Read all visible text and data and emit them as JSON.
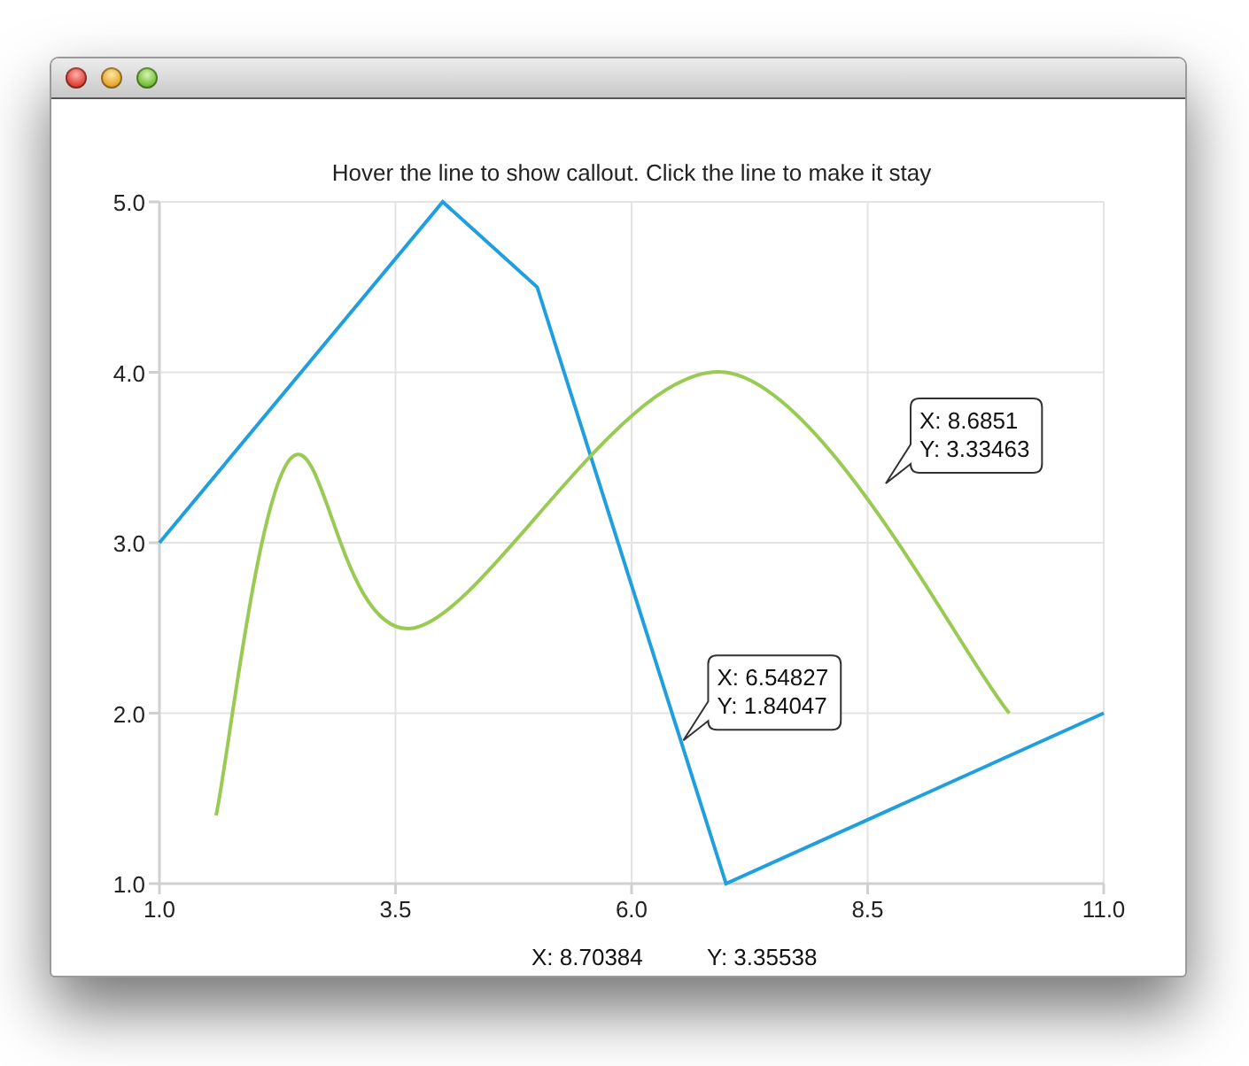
{
  "window": {
    "buttons": [
      {
        "kind": "close"
      },
      {
        "kind": "minimize"
      },
      {
        "kind": "zoom"
      }
    ]
  },
  "chart": {
    "chart_data": {
      "type": "line",
      "title": "Hover the line to show callout. Click the line to make it stay",
      "xlim": [
        1,
        11
      ],
      "ylim": [
        1,
        5
      ],
      "xticks": [
        {
          "value": 1,
          "label": "1.0"
        },
        {
          "value": 3.5,
          "label": "3.5"
        },
        {
          "value": 6,
          "label": "6.0"
        },
        {
          "value": 8.5,
          "label": "8.5"
        },
        {
          "value": 11,
          "label": "11.0"
        }
      ],
      "yticks": [
        {
          "value": 1,
          "label": "1.0"
        },
        {
          "value": 2,
          "label": "2.0"
        },
        {
          "value": 3,
          "label": "3.0"
        },
        {
          "value": 4,
          "label": "4.0"
        },
        {
          "value": 5,
          "label": "5.0"
        }
      ],
      "series": [
        {
          "color": "#209fdf",
          "x": [
            1,
            4,
            5,
            7,
            11
          ],
          "values": [
            3,
            5,
            4.5,
            1,
            2
          ]
        },
        {
          "color": "#99ca53",
          "x": [
            1.6,
            2.4,
            3.7,
            7,
            10
          ],
          "values": [
            1.4,
            3.5,
            2.5,
            4,
            2
          ]
        }
      ],
      "grid": true,
      "annotations": [
        "X: 8.6851\nY: 3.33463",
        {
          "x": 6.54827,
          "y": 1.84047,
          "text": "X: 6.54827\nY: 1.84047"
        }
      ]
    },
    "series_styles": [
      {
        "kind": "line"
      },
      {
        "kind": "spline"
      }
    ],
    "readout": {
      "x": "X: 8.70384",
      "y": "Y: 3.35538"
    }
  }
}
